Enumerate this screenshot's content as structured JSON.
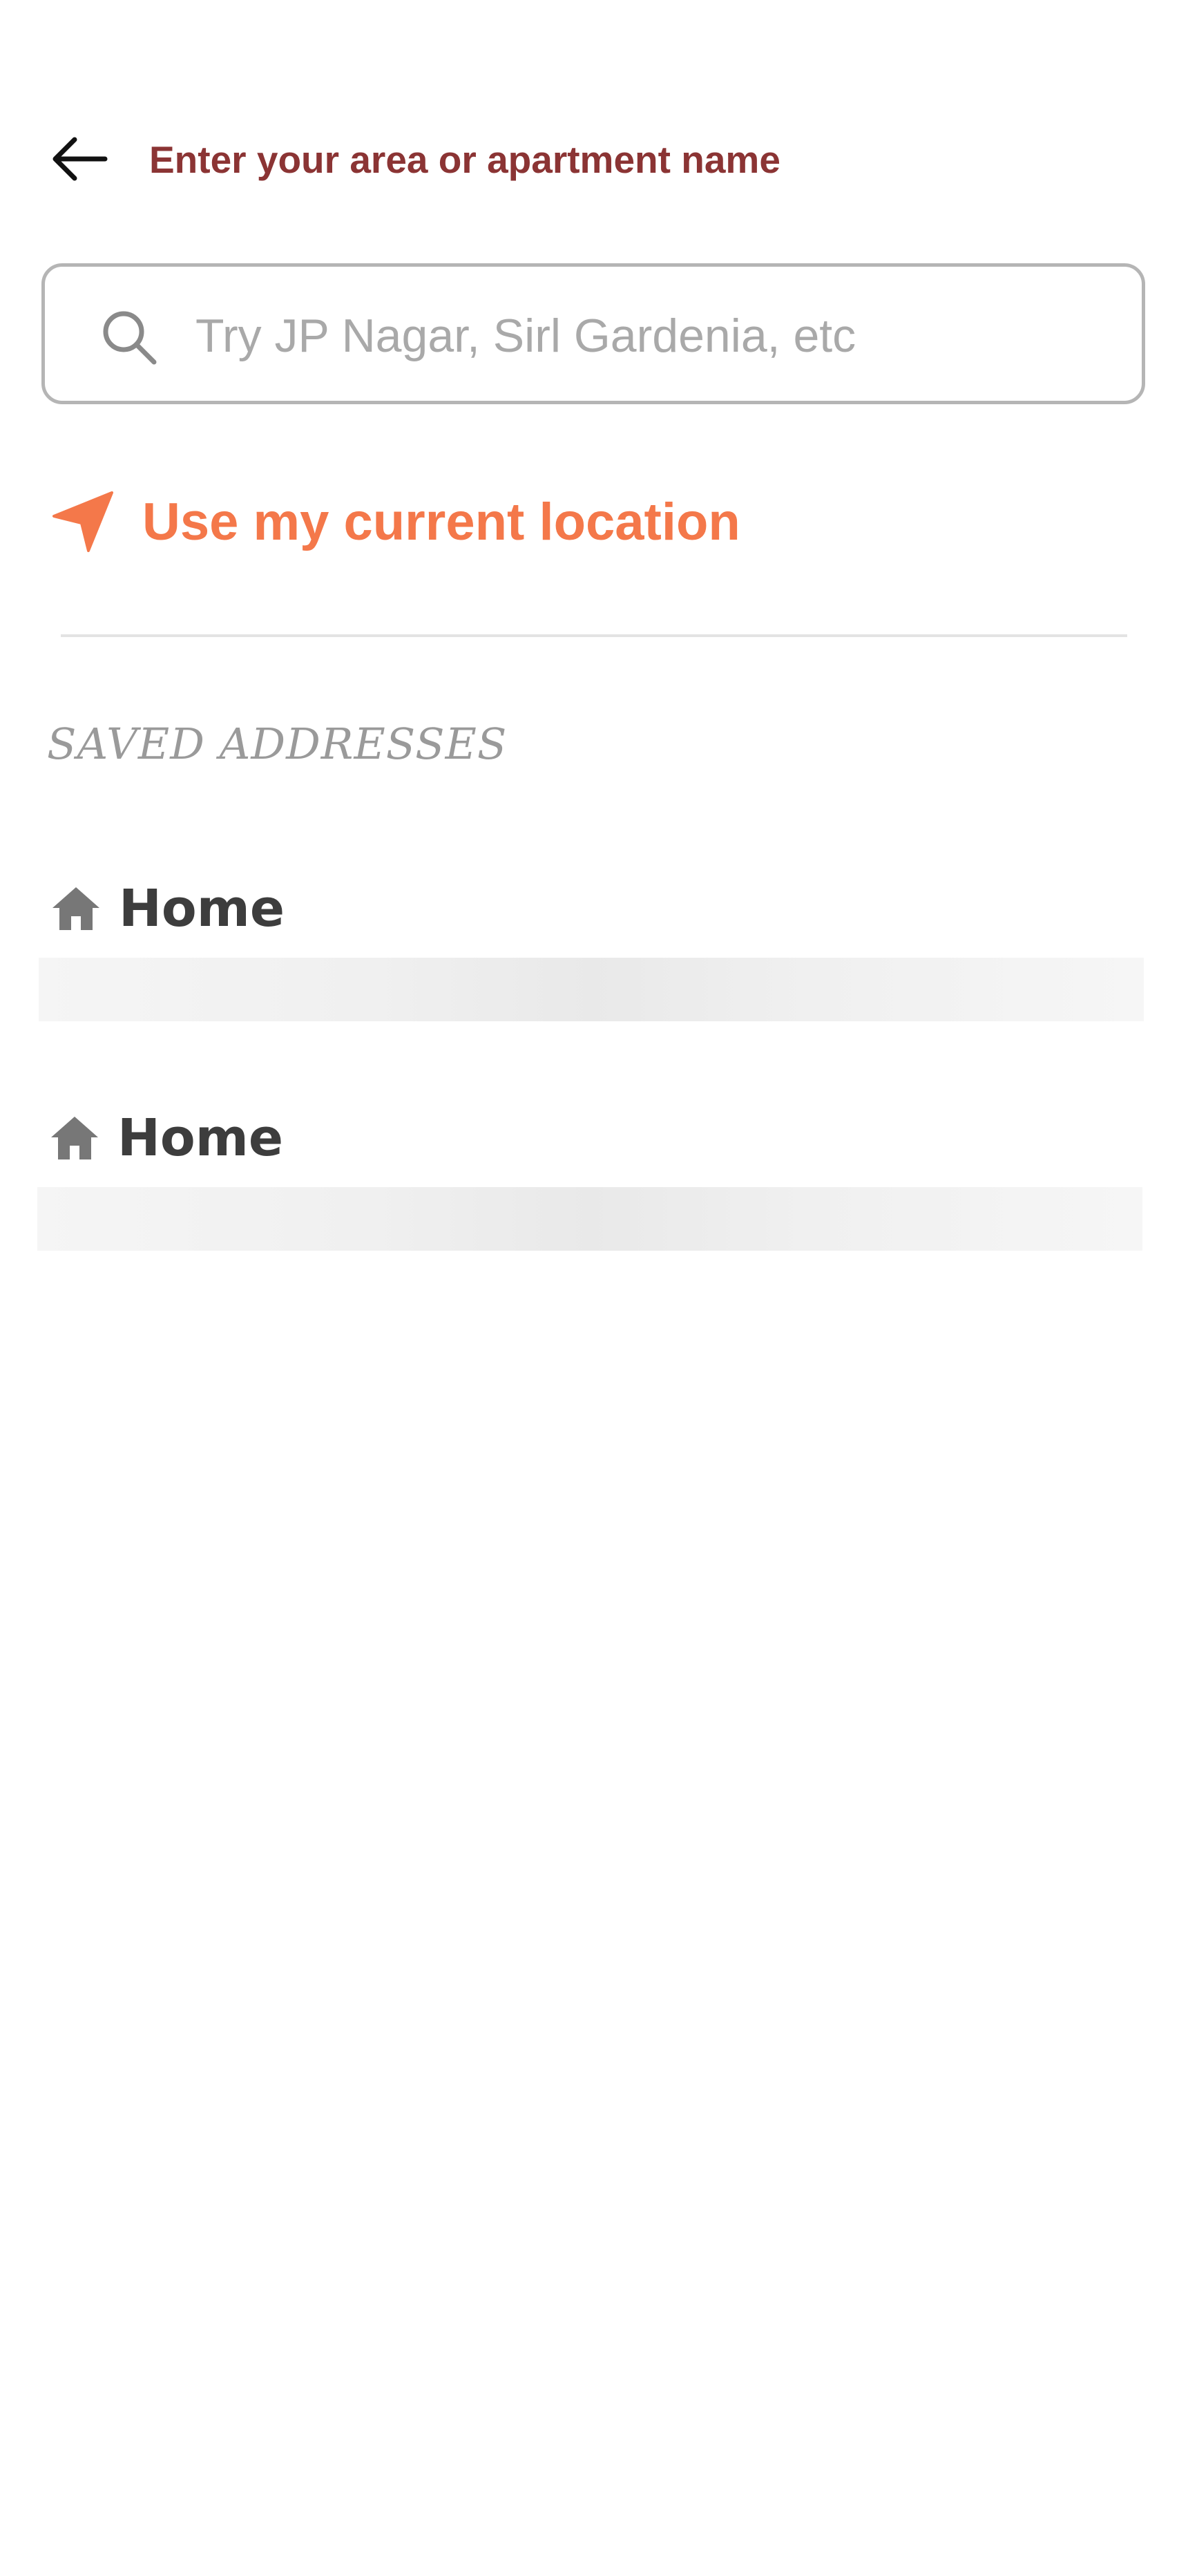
{
  "header": {
    "back_icon": "arrow-left-icon",
    "title": "Enter your area or apartment name"
  },
  "search": {
    "icon": "search-icon",
    "placeholder": "Try JP Nagar, Sirl Gardenia, etc",
    "value": ""
  },
  "current_location": {
    "icon": "navigation-arrow-icon",
    "label": "Use my current location"
  },
  "saved_addresses": {
    "title": "SAVED ADDRESSES",
    "items": [
      {
        "icon": "home-icon",
        "label": "Home",
        "address_loading": true
      },
      {
        "icon": "home-icon",
        "label": "Home",
        "address_loading": true
      }
    ]
  },
  "colors": {
    "title": "#8b3434",
    "accent": "#f4784a",
    "border": "#b5b5b5",
    "placeholder": "#a9a9a9",
    "section_title": "#9a9a9a",
    "text_dark": "#3d3d3d",
    "icon_gray": "#777777"
  }
}
